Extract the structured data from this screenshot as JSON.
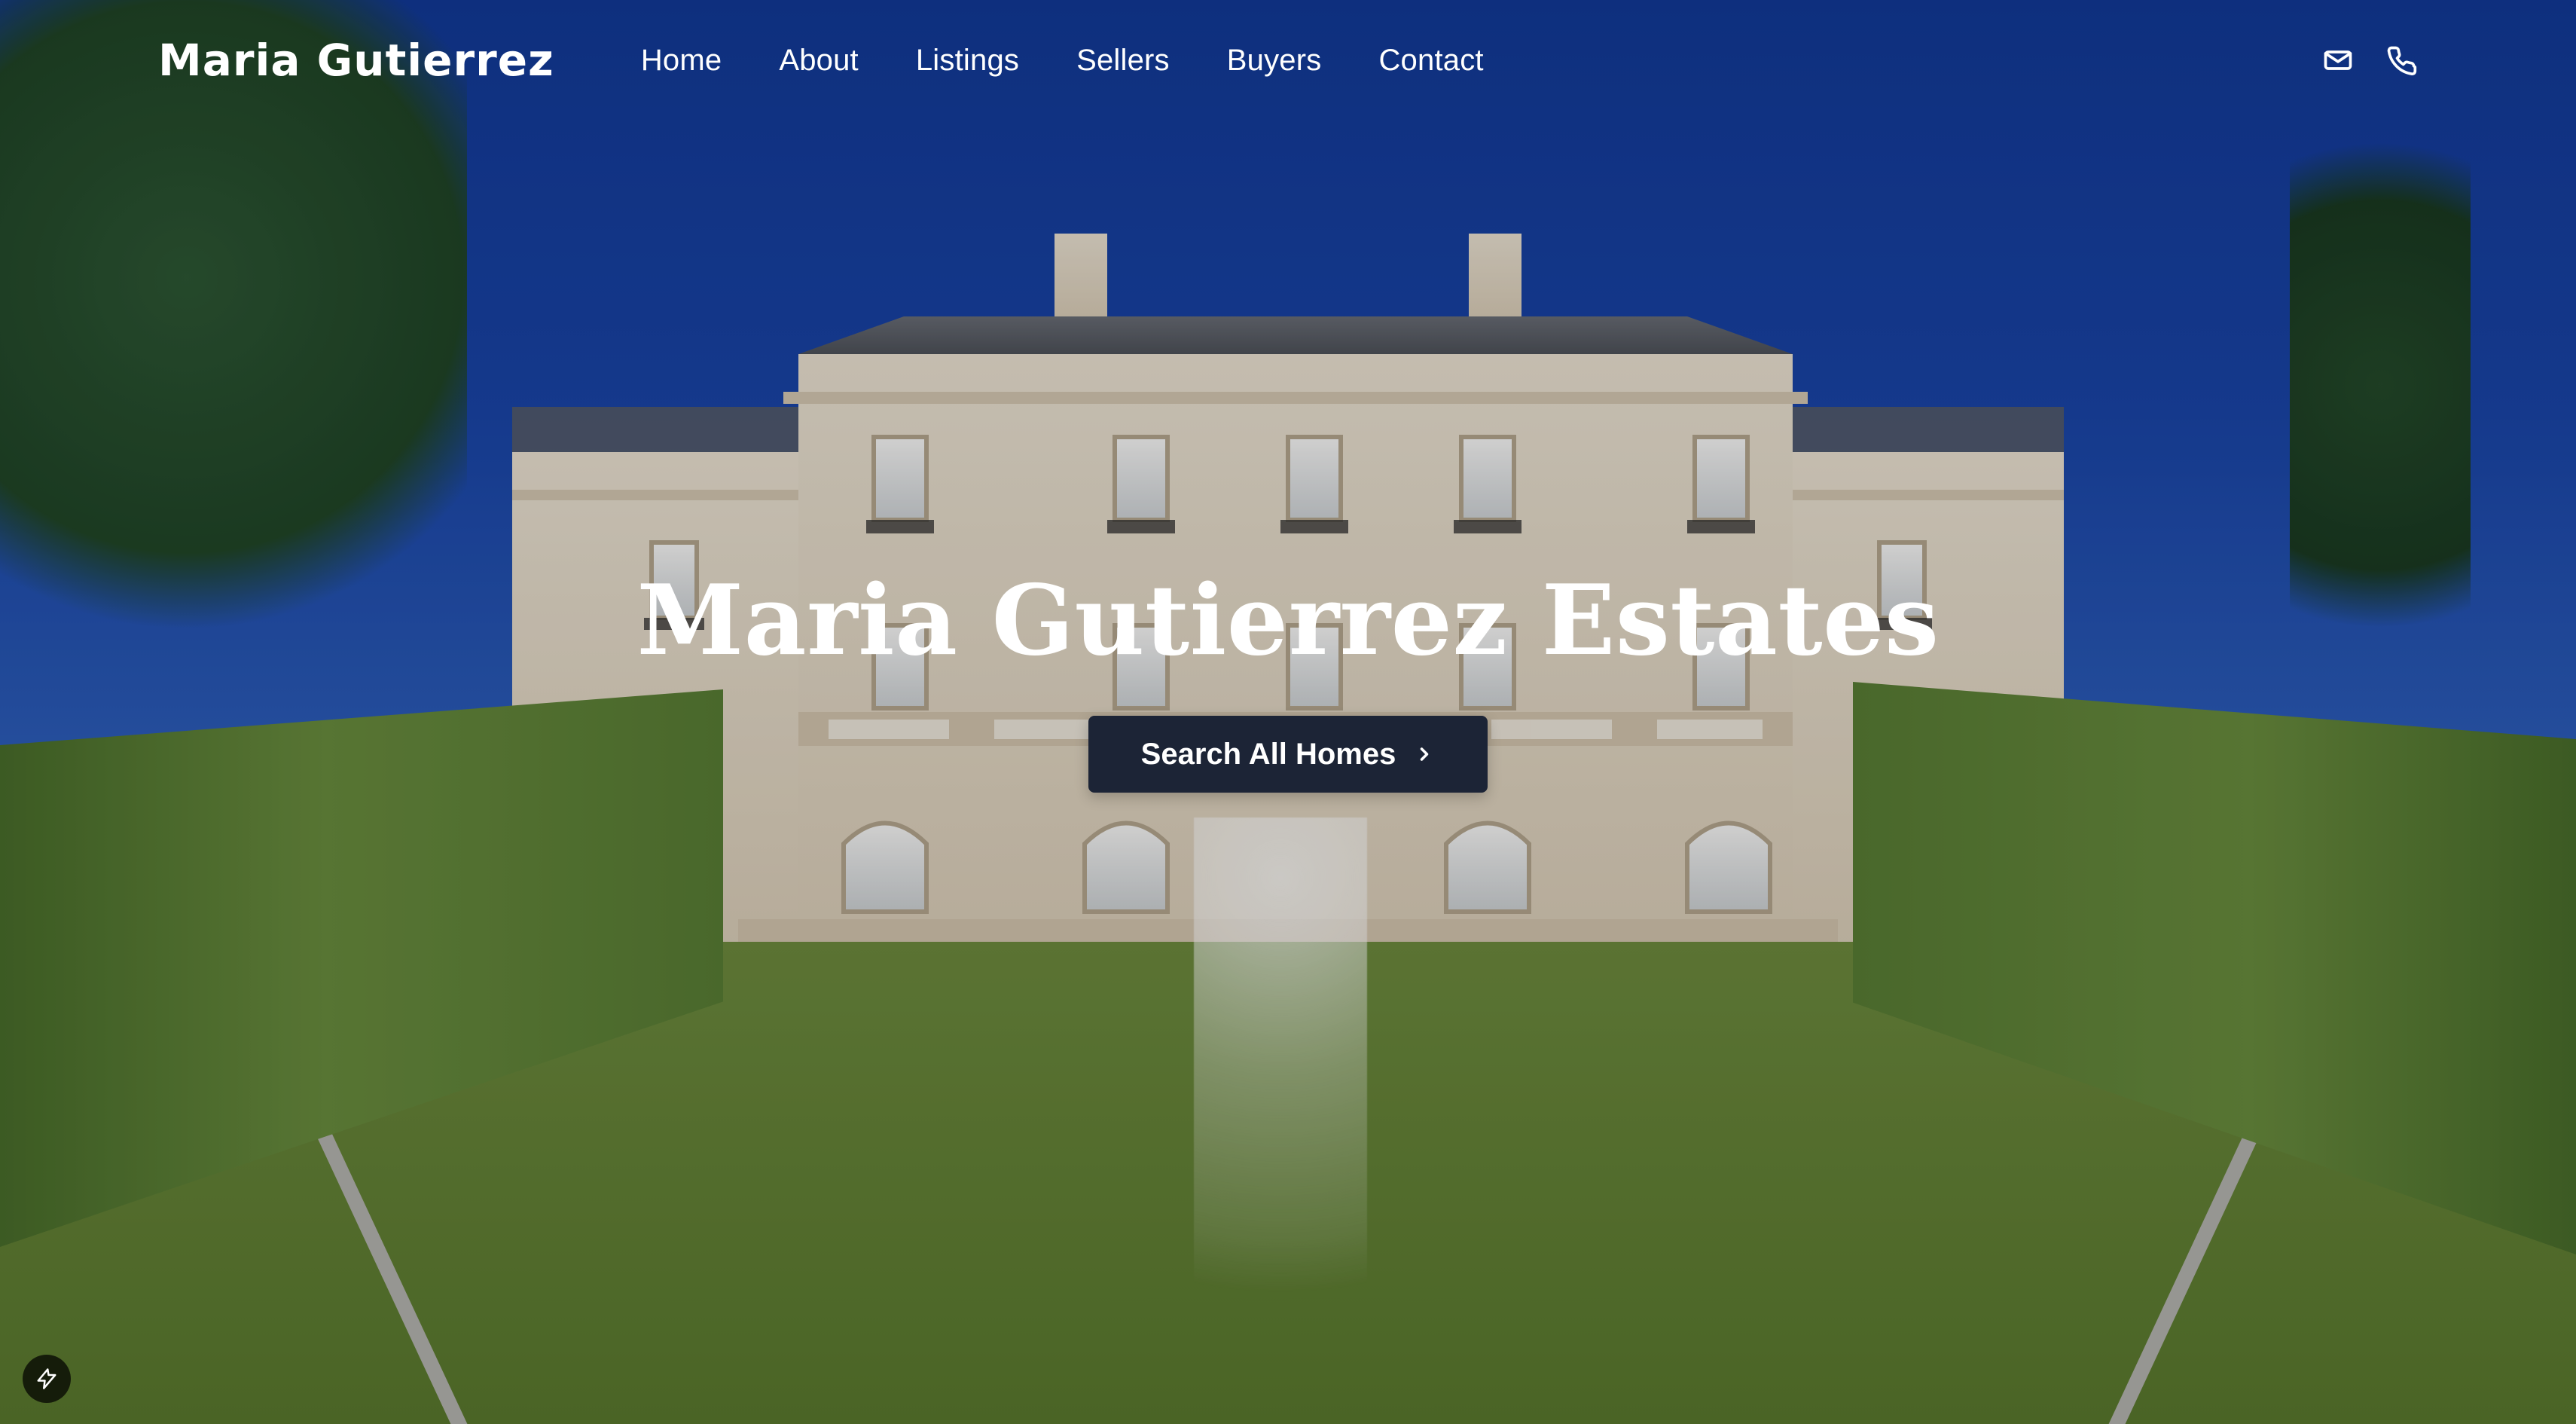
{
  "brand": {
    "name": "Maria Gutierrez"
  },
  "nav": {
    "items": [
      "Home",
      "About",
      "Listings",
      "Sellers",
      "Buyers",
      "Contact"
    ],
    "icons": [
      "mail-icon",
      "phone-icon"
    ]
  },
  "hero": {
    "title": "Maria Gutierrez Estates",
    "cta_label": "Search All Homes",
    "cta_icon": "chevron-right-icon"
  },
  "fab": {
    "icon": "bolt-icon"
  },
  "colors": {
    "cta_bg": "#1c2436",
    "text": "#ffffff"
  }
}
